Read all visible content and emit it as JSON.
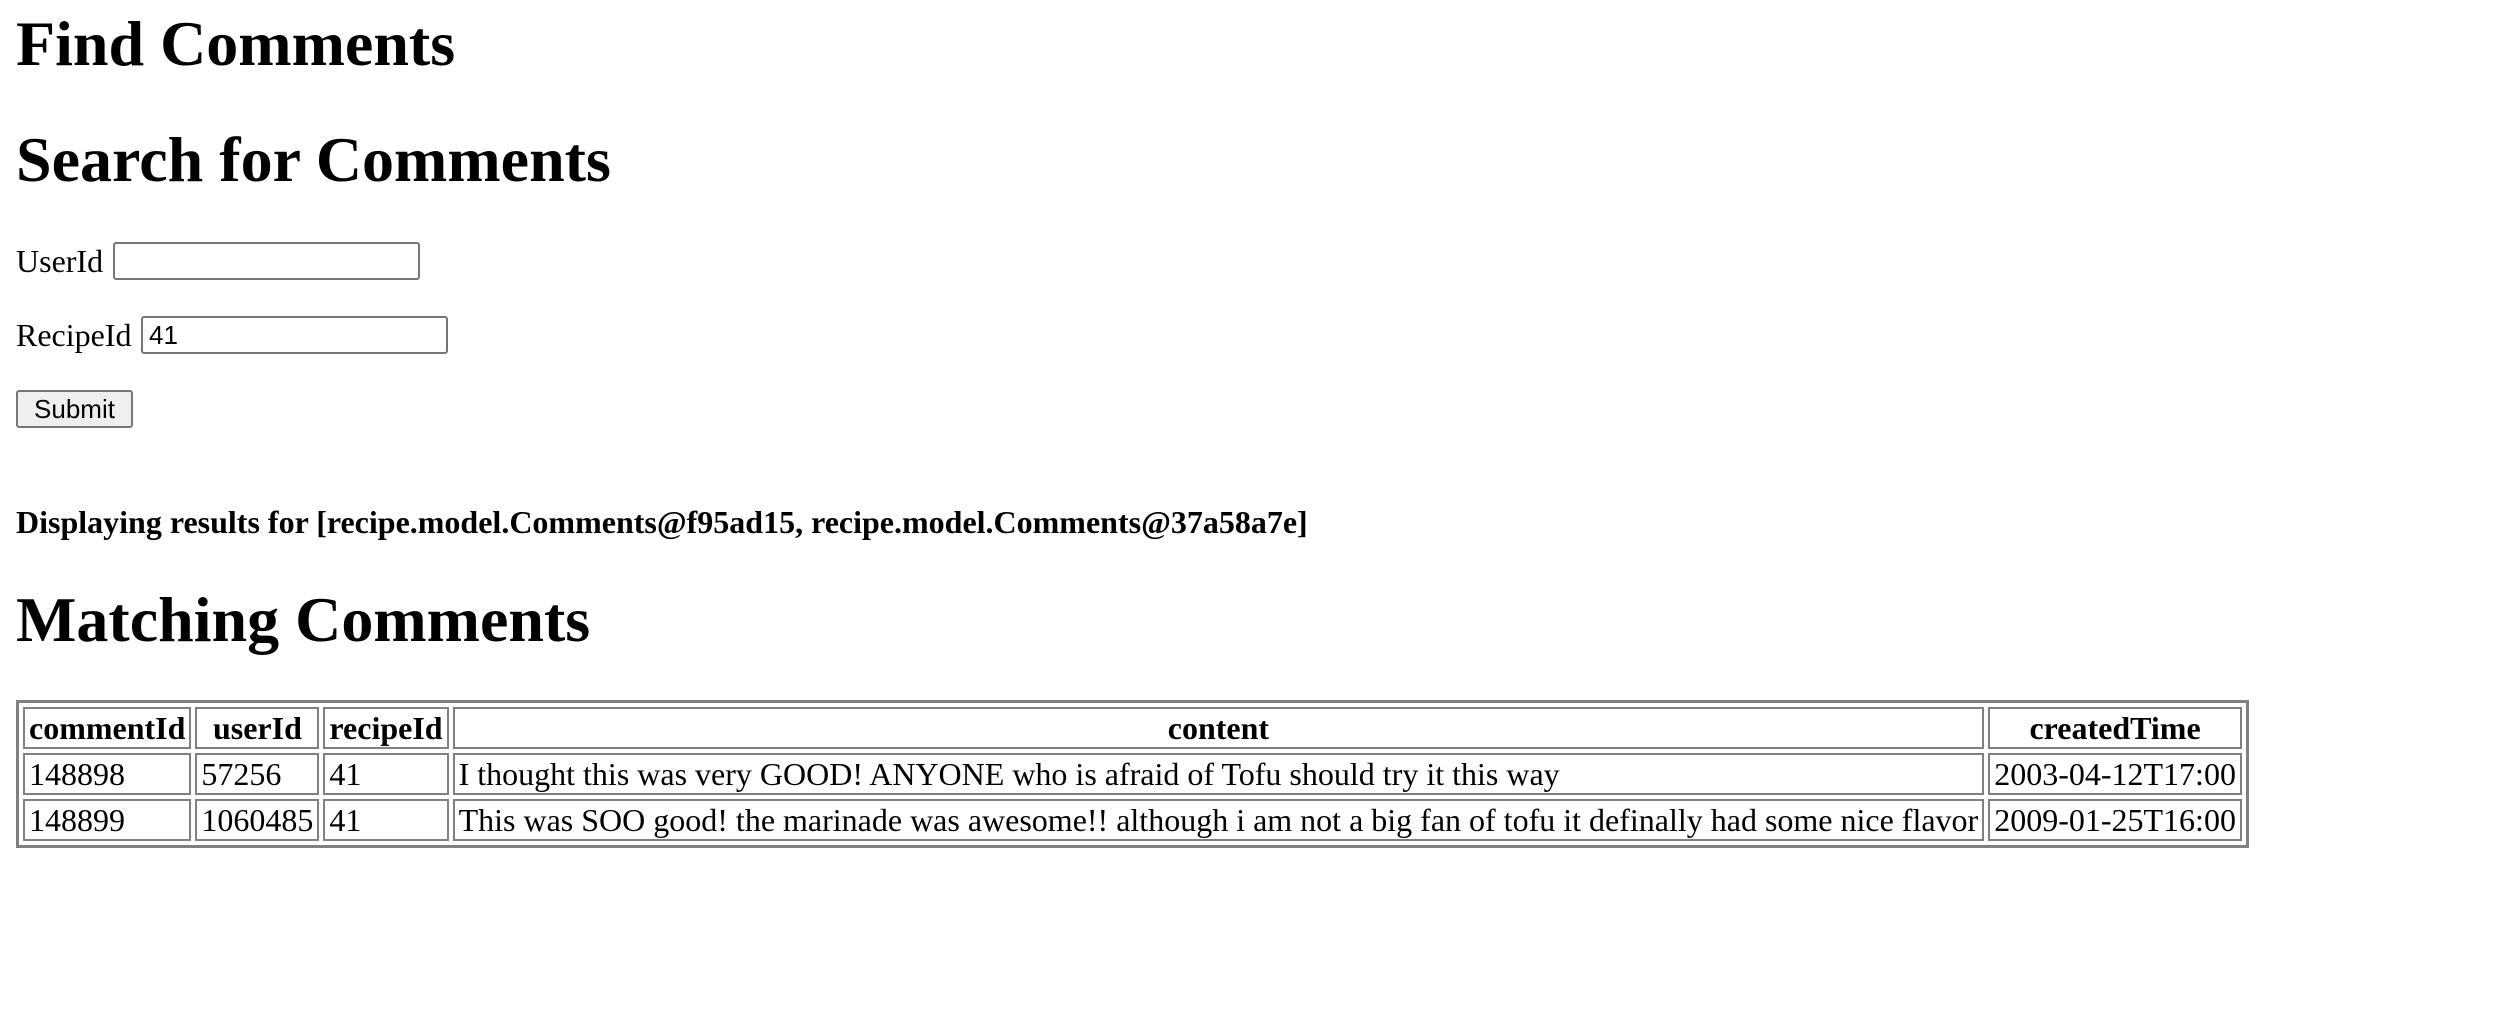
{
  "page": {
    "title": "Find Comments",
    "form_heading": "Search for Comments"
  },
  "form": {
    "userid": {
      "label": "UserId",
      "value": ""
    },
    "recipeid": {
      "label": "RecipeId",
      "value": "41"
    },
    "submit_label": "Submit"
  },
  "status": {
    "message": "Displaying results for [recipe.model.Comments@f95ad15, recipe.model.Comments@37a58a7e]"
  },
  "results": {
    "heading": "Matching Comments",
    "columns": [
      "commentId",
      "userId",
      "recipeId",
      "content",
      "createdTime"
    ],
    "rows": [
      [
        "148898",
        "57256",
        "41",
        "I thought this was very GOOD! ANYONE who is afraid of Tofu should try it this way",
        "2003-04-12T17:00"
      ],
      [
        "148899",
        "1060485",
        "41",
        "This was SOO good! the marinade was awesome!! although i am not a big fan of tofu it definally had some nice flavor",
        "2009-01-25T16:00"
      ]
    ]
  }
}
